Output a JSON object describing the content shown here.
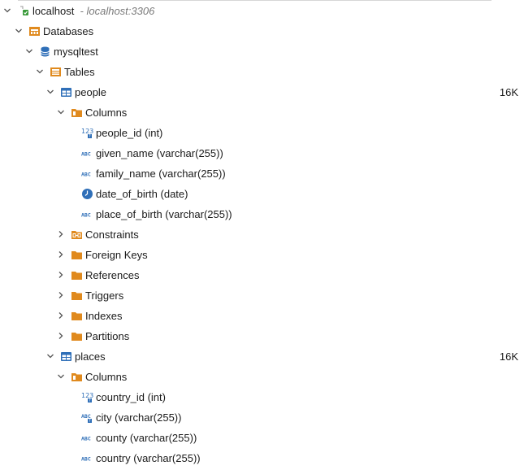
{
  "connection": {
    "name": "localhost",
    "address": "- localhost:3306"
  },
  "databases_label": "Databases",
  "schema": "mysqltest",
  "tables_label": "Tables",
  "folders": {
    "columns": "Columns",
    "constraints": "Constraints",
    "foreign_keys": "Foreign Keys",
    "references": "References",
    "triggers": "Triggers",
    "indexes": "Indexes",
    "partitions": "Partitions"
  },
  "tables": [
    {
      "name": "people",
      "size": "16K",
      "columns": [
        {
          "label": "people_id (int)",
          "icon": "numeric-key-icon"
        },
        {
          "label": "given_name (varchar(255))",
          "icon": "text-abc-icon"
        },
        {
          "label": "family_name (varchar(255))",
          "icon": "text-abc-icon"
        },
        {
          "label": "date_of_birth (date)",
          "icon": "clock-icon"
        },
        {
          "label": "place_of_birth (varchar(255))",
          "icon": "text-abc-icon"
        }
      ]
    },
    {
      "name": "places",
      "size": "16K",
      "columns": [
        {
          "label": "country_id (int)",
          "icon": "numeric-key-icon"
        },
        {
          "label": "city (varchar(255))",
          "icon": "text-abc-key-icon"
        },
        {
          "label": "county (varchar(255))",
          "icon": "text-abc-icon"
        },
        {
          "label": "country (varchar(255))",
          "icon": "text-abc-icon"
        }
      ]
    }
  ],
  "colors": {
    "folder": "#e08a1e",
    "table": "#2f6fb8",
    "text": "#1a1a1a",
    "muted": "#7a7a7a"
  }
}
